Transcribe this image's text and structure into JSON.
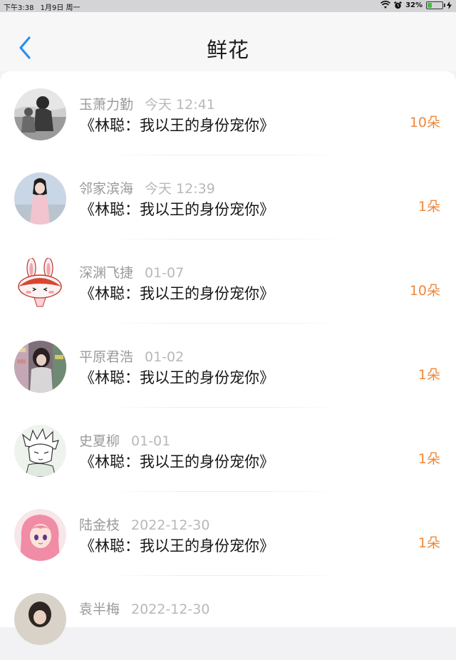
{
  "status_bar": {
    "time": "下午3:38",
    "date": "1月9日 周一",
    "battery": "32%",
    "battery_level": 0.32
  },
  "nav": {
    "title": "鲜花",
    "back_icon": "chevron-left-icon",
    "accent": "#2b8ff0"
  },
  "items": [
    {
      "name": "玉萧力勤",
      "time": "今天 12:41",
      "title": "《林聪：我以王的身份宠你》",
      "amount": "10朵"
    },
    {
      "name": "邻家滨海",
      "time": "今天 12:39",
      "title": "《林聪：我以王的身份宠你》",
      "amount": "1朵"
    },
    {
      "name": "深渊飞捷",
      "time": "01-07",
      "title": "《林聪：我以王的身份宠你》",
      "amount": "10朵"
    },
    {
      "name": "平原君浩",
      "time": "01-02",
      "title": "《林聪：我以王的身份宠你》",
      "amount": "1朵"
    },
    {
      "name": "史夏柳",
      "time": "01-01",
      "title": "《林聪：我以王的身份宠你》",
      "amount": "1朵"
    },
    {
      "name": "陆金枝",
      "time": "2022-12-30",
      "title": "《林聪：我以王的身份宠你》",
      "amount": "1朵"
    },
    {
      "name": "袁半梅",
      "time": "2022-12-30",
      "title": "",
      "amount": ""
    }
  ],
  "colors": {
    "amount": "#f0883a",
    "meta_text": "#9a9a9a"
  }
}
